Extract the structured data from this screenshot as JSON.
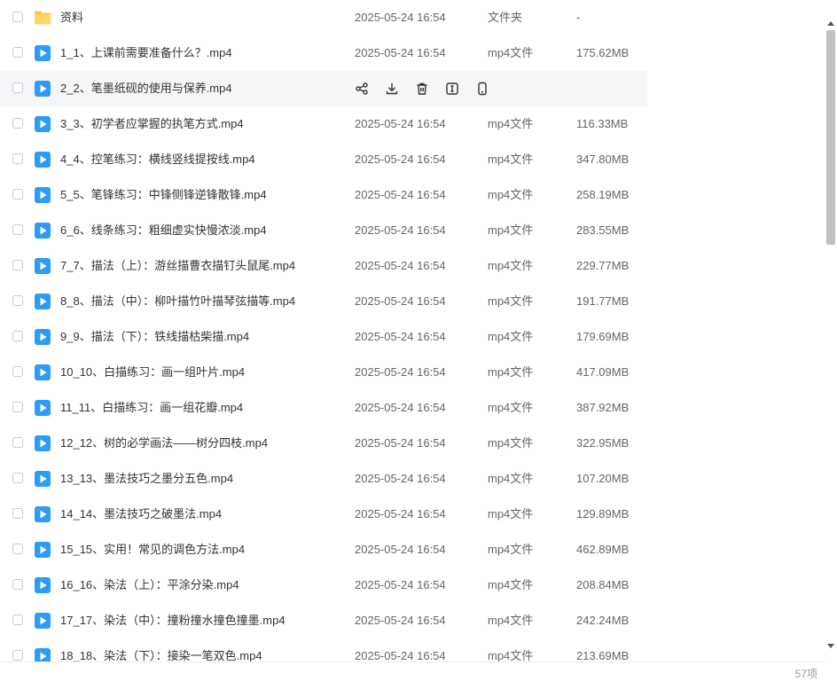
{
  "colors": {
    "folder": "#FFC53D",
    "video": "#2E9BF5",
    "hover_row": "#F5F6F8",
    "action_icon": "#333333"
  },
  "hover_actions": [
    "share-icon",
    "download-icon",
    "delete-icon",
    "rename-icon",
    "mobile-icon"
  ],
  "files": [
    {
      "icon": "folder",
      "name": "资料",
      "date": "2025-05-24 16:54",
      "type": "文件夹",
      "size": "-"
    },
    {
      "icon": "video",
      "name": "1_1、上课前需要准备什么？.mp4",
      "date": "2025-05-24 16:54",
      "type": "mp4文件",
      "size": "175.62MB"
    },
    {
      "icon": "video",
      "name": "2_2、笔墨纸砚的使用与保养.mp4",
      "date": "",
      "type": "",
      "size": "",
      "hover": true
    },
    {
      "icon": "video",
      "name": "3_3、初学者应掌握的执笔方式.mp4",
      "date": "2025-05-24 16:54",
      "type": "mp4文件",
      "size": "116.33MB"
    },
    {
      "icon": "video",
      "name": "4_4、控笔练习：横线竖线提按线.mp4",
      "date": "2025-05-24 16:54",
      "type": "mp4文件",
      "size": "347.80MB"
    },
    {
      "icon": "video",
      "name": "5_5、笔锋练习：中锋侧锋逆锋散锋.mp4",
      "date": "2025-05-24 16:54",
      "type": "mp4文件",
      "size": "258.19MB"
    },
    {
      "icon": "video",
      "name": "6_6、线条练习：粗细虚实快慢浓淡.mp4",
      "date": "2025-05-24 16:54",
      "type": "mp4文件",
      "size": "283.55MB"
    },
    {
      "icon": "video",
      "name": "7_7、描法（上）：游丝描曹衣描钉头鼠尾.mp4",
      "date": "2025-05-24 16:54",
      "type": "mp4文件",
      "size": "229.77MB"
    },
    {
      "icon": "video",
      "name": "8_8、描法（中）：柳叶描竹叶描琴弦描等.mp4",
      "date": "2025-05-24 16:54",
      "type": "mp4文件",
      "size": "191.77MB"
    },
    {
      "icon": "video",
      "name": "9_9、描法（下）：铁线描枯柴描.mp4",
      "date": "2025-05-24 16:54",
      "type": "mp4文件",
      "size": "179.69MB"
    },
    {
      "icon": "video",
      "name": "10_10、白描练习：画一组叶片.mp4",
      "date": "2025-05-24 16:54",
      "type": "mp4文件",
      "size": "417.09MB"
    },
    {
      "icon": "video",
      "name": "11_11、白描练习：画一组花瓣.mp4",
      "date": "2025-05-24 16:54",
      "type": "mp4文件",
      "size": "387.92MB"
    },
    {
      "icon": "video",
      "name": "12_12、树的必学画法——树分四枝.mp4",
      "date": "2025-05-24 16:54",
      "type": "mp4文件",
      "size": "322.95MB"
    },
    {
      "icon": "video",
      "name": "13_13、墨法技巧之墨分五色.mp4",
      "date": "2025-05-24 16:54",
      "type": "mp4文件",
      "size": "107.20MB"
    },
    {
      "icon": "video",
      "name": "14_14、墨法技巧之破墨法.mp4",
      "date": "2025-05-24 16:54",
      "type": "mp4文件",
      "size": "129.89MB"
    },
    {
      "icon": "video",
      "name": "15_15、实用！常见的调色方法.mp4",
      "date": "2025-05-24 16:54",
      "type": "mp4文件",
      "size": "462.89MB"
    },
    {
      "icon": "video",
      "name": "16_16、染法（上）：平涂分染.mp4",
      "date": "2025-05-24 16:54",
      "type": "mp4文件",
      "size": "208.84MB"
    },
    {
      "icon": "video",
      "name": "17_17、染法（中）：撞粉撞水撞色撞墨.mp4",
      "date": "2025-05-24 16:54",
      "type": "mp4文件",
      "size": "242.24MB"
    },
    {
      "icon": "video",
      "name": "18_18、染法（下）：接染一笔双色.mp4",
      "date": "2025-05-24 16:54",
      "type": "mp4文件",
      "size": "213.69MB"
    }
  ],
  "footer": {
    "count": "57项"
  }
}
